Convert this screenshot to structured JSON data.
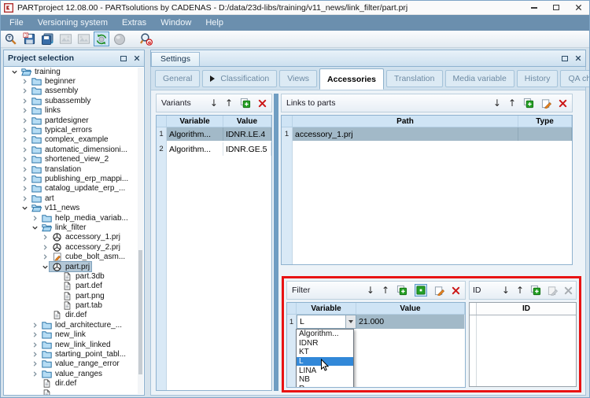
{
  "window": {
    "title": "PARTproject 12.08.00 - PARTsolutions by CADENAS - D:/data/23d-libs/training/v11_news/link_filter/part.prj"
  },
  "menu": {
    "items": [
      "File",
      "Versioning system",
      "Extras",
      "Window",
      "Help"
    ]
  },
  "toolbar": {
    "buttons": [
      {
        "name": "search-project",
        "pressed": false,
        "gap": false
      },
      {
        "name": "save",
        "pressed": false,
        "gap": false
      },
      {
        "name": "save-all",
        "pressed": false,
        "gap": false
      },
      {
        "name": "image-export-1",
        "pressed": false,
        "gap": false,
        "disabled": true
      },
      {
        "name": "image-export-2",
        "pressed": false,
        "gap": false,
        "disabled": true
      },
      {
        "name": "sync",
        "pressed": true,
        "gap": false
      },
      {
        "name": "publish-globe",
        "pressed": false,
        "gap": false,
        "disabled": true
      },
      {
        "name": "preview-search",
        "pressed": false,
        "gap": true
      }
    ]
  },
  "project_selection": {
    "title": "Project selection",
    "tree": [
      {
        "label": "training",
        "level": 0,
        "icon": "folder-open",
        "chevron": "expanded",
        "selected": false
      },
      {
        "label": "beginner",
        "level": 1,
        "icon": "folder",
        "chevron": "collapsed",
        "selected": false
      },
      {
        "label": "assembly",
        "level": 1,
        "icon": "folder",
        "chevron": "collapsed",
        "selected": false
      },
      {
        "label": "subassembly",
        "level": 1,
        "icon": "folder",
        "chevron": "collapsed",
        "selected": false
      },
      {
        "label": "links",
        "level": 1,
        "icon": "folder",
        "chevron": "collapsed",
        "selected": false
      },
      {
        "label": "partdesigner",
        "level": 1,
        "icon": "folder",
        "chevron": "collapsed",
        "selected": false
      },
      {
        "label": "typical_errors",
        "level": 1,
        "icon": "folder",
        "chevron": "collapsed",
        "selected": false
      },
      {
        "label": "complex_example",
        "level": 1,
        "icon": "folder",
        "chevron": "collapsed",
        "selected": false
      },
      {
        "label": "automatic_dimensioni...",
        "level": 1,
        "icon": "folder",
        "chevron": "collapsed",
        "selected": false
      },
      {
        "label": "shortened_view_2",
        "level": 1,
        "icon": "folder",
        "chevron": "collapsed",
        "selected": false
      },
      {
        "label": "translation",
        "level": 1,
        "icon": "folder",
        "chevron": "collapsed",
        "selected": false
      },
      {
        "label": "publishing_erp_mappi...",
        "level": 1,
        "icon": "folder",
        "chevron": "collapsed",
        "selected": false
      },
      {
        "label": "catalog_update_erp_...",
        "level": 1,
        "icon": "folder",
        "chevron": "collapsed",
        "selected": false
      },
      {
        "label": "art",
        "level": 1,
        "icon": "folder",
        "chevron": "collapsed",
        "selected": false
      },
      {
        "label": "v11_news",
        "level": 1,
        "icon": "folder-open",
        "chevron": "expanded",
        "selected": false
      },
      {
        "label": "help_media_variab...",
        "level": 2,
        "icon": "folder",
        "chevron": "collapsed",
        "selected": false
      },
      {
        "label": "link_filter",
        "level": 2,
        "icon": "folder-open",
        "chevron": "expanded",
        "selected": false
      },
      {
        "label": "accessory_1.prj",
        "level": 3,
        "icon": "prj",
        "chevron": "collapsed",
        "selected": false
      },
      {
        "label": "accessory_2.prj",
        "level": 3,
        "icon": "prj",
        "chevron": "collapsed",
        "selected": false
      },
      {
        "label": "cube_bolt_asm...",
        "level": 3,
        "icon": "doc-edit",
        "chevron": "collapsed",
        "selected": false
      },
      {
        "label": "part.prj",
        "level": 3,
        "icon": "prj",
        "chevron": "expanded",
        "selected": true
      },
      {
        "label": "part.3db",
        "level": 4,
        "icon": "document",
        "chevron": "none",
        "selected": false
      },
      {
        "label": "part.def",
        "level": 4,
        "icon": "document",
        "chevron": "none",
        "selected": false
      },
      {
        "label": "part.png",
        "level": 4,
        "icon": "document",
        "chevron": "none",
        "selected": false
      },
      {
        "label": "part.tab",
        "level": 4,
        "icon": "document",
        "chevron": "none",
        "selected": false
      },
      {
        "label": "dir.def",
        "level": 3,
        "icon": "document",
        "chevron": "none",
        "selected": false
      },
      {
        "label": "lod_architecture_...",
        "level": 2,
        "icon": "folder",
        "chevron": "collapsed",
        "selected": false
      },
      {
        "label": "new_link",
        "level": 2,
        "icon": "folder",
        "chevron": "collapsed",
        "selected": false
      },
      {
        "label": "new_link_linked",
        "level": 2,
        "icon": "folder",
        "chevron": "collapsed",
        "selected": false
      },
      {
        "label": "starting_point_tabl...",
        "level": 2,
        "icon": "folder",
        "chevron": "collapsed",
        "selected": false
      },
      {
        "label": "value_range_error",
        "level": 2,
        "icon": "folder",
        "chevron": "collapsed",
        "selected": false
      },
      {
        "label": "value_ranges",
        "level": 2,
        "icon": "folder",
        "chevron": "collapsed",
        "selected": false
      },
      {
        "label": "dir.def",
        "level": 2,
        "icon": "document",
        "chevron": "none",
        "selected": false
      },
      {
        "label": "",
        "level": 2,
        "icon": "document",
        "chevron": "none",
        "selected": false
      }
    ]
  },
  "settings": {
    "title": "Settings",
    "tabs": [
      {
        "label": "General",
        "active": false,
        "play_icon": false
      },
      {
        "label": "Classification",
        "active": false,
        "play_icon": true
      },
      {
        "label": "Views",
        "active": false,
        "play_icon": false
      },
      {
        "label": "Accessories",
        "active": true,
        "play_icon": false
      },
      {
        "label": "Translation",
        "active": false,
        "play_icon": false
      },
      {
        "label": "Media variable",
        "active": false,
        "play_icon": false
      },
      {
        "label": "History",
        "active": false,
        "play_icon": false
      },
      {
        "label": "QA check",
        "active": false,
        "play_icon": false
      }
    ]
  },
  "variants": {
    "title": "Variants",
    "toolbar": [
      "move-down",
      "move-up",
      "add",
      "delete"
    ],
    "columns": [
      "Variable",
      "Value"
    ],
    "rows": [
      {
        "num": "1",
        "cells": [
          "Algorithm...",
          "IDNR.LE.4"
        ],
        "selected": true
      },
      {
        "num": "2",
        "cells": [
          "Algorithm...",
          "IDNR.GE.5"
        ],
        "selected": false
      }
    ]
  },
  "links_to_parts": {
    "title": "Links to parts",
    "toolbar": [
      "move-down",
      "move-up",
      "add",
      "edit",
      "delete"
    ],
    "columns": [
      "Path",
      "Type"
    ],
    "rows": [
      {
        "num": "1",
        "cells": [
          "accessory_1.prj",
          ""
        ],
        "selected": true
      }
    ]
  },
  "filter": {
    "title": "Filter",
    "toolbar": [
      "move-down",
      "move-up",
      "add",
      "add-box",
      "edit",
      "delete"
    ],
    "columns": [
      "Variable",
      "Value"
    ],
    "rows": [
      {
        "num": "1",
        "variable": "L",
        "value": "21.000",
        "selected": true
      }
    ],
    "dropdown": {
      "options": [
        "Algorithm...",
        "IDNR",
        "KT",
        "L",
        "LINA",
        "NB",
        "R"
      ],
      "highlighted": "L"
    }
  },
  "id_panel": {
    "title": "ID",
    "toolbar": [
      "move-down",
      "move-up",
      "add",
      "edit-disabled",
      "delete-disabled"
    ],
    "columns": [
      "ID"
    ],
    "rows": []
  },
  "colors": {
    "menu_bar": "#6b8fae",
    "highlight_border": "#e81313",
    "row_selection": "#a2b9c8",
    "dropdown_selection": "#3288d8",
    "table_header": "#cfe4f5",
    "tree_selection": "#b3c7d6"
  }
}
